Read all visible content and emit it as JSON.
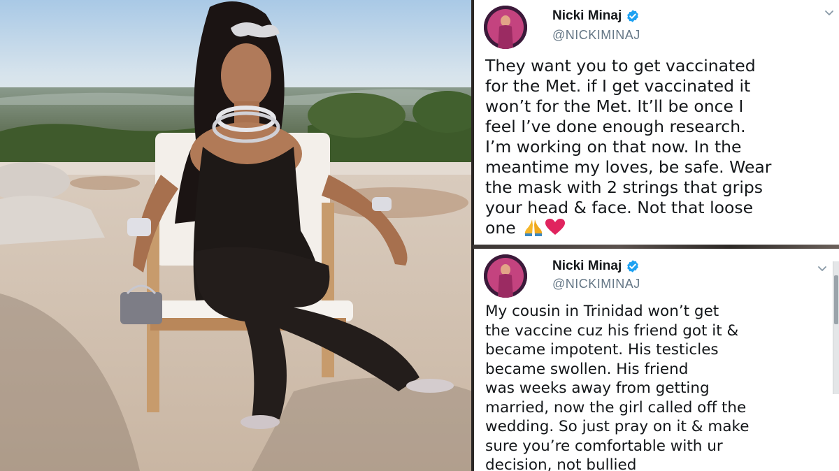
{
  "tweets": [
    {
      "name": "Nicki Minaj",
      "handle": "@NICKIMINAJ",
      "lines": [
        "They want you to get vaccinated",
        "for the Met. if I get vaccinated it",
        "won’t for the Met. It’ll be once I",
        "feel I’ve done enough research.",
        "I’m working on that now. In the",
        "meantime my loves, be safe. Wear",
        "the mask with 2 strings that grips",
        "your head & face. Not that loose",
        "one"
      ]
    },
    {
      "name": "Nicki Minaj",
      "handle": "@NICKIMINAJ",
      "lines": [
        "My cousin in Trinidad won’t get",
        "the vaccine cuz his friend got it &",
        "became impotent. His testicles",
        "became swollen. His friend",
        "was weeks away from getting",
        "married, now the girl called off the",
        "wedding. So just pray on it & make",
        "sure you’re comfortable with ur",
        "decision, not bullied"
      ]
    }
  ],
  "icons": {
    "verified": "verified-badge-icon",
    "menu": "chevron-down-icon",
    "pray": "folded-hands-emoji",
    "heart": "red-heart-emoji"
  },
  "colors": {
    "verified_blue": "#1da1f2",
    "text": "#14171a",
    "handle": "#657786",
    "heart": "#e0245e"
  }
}
